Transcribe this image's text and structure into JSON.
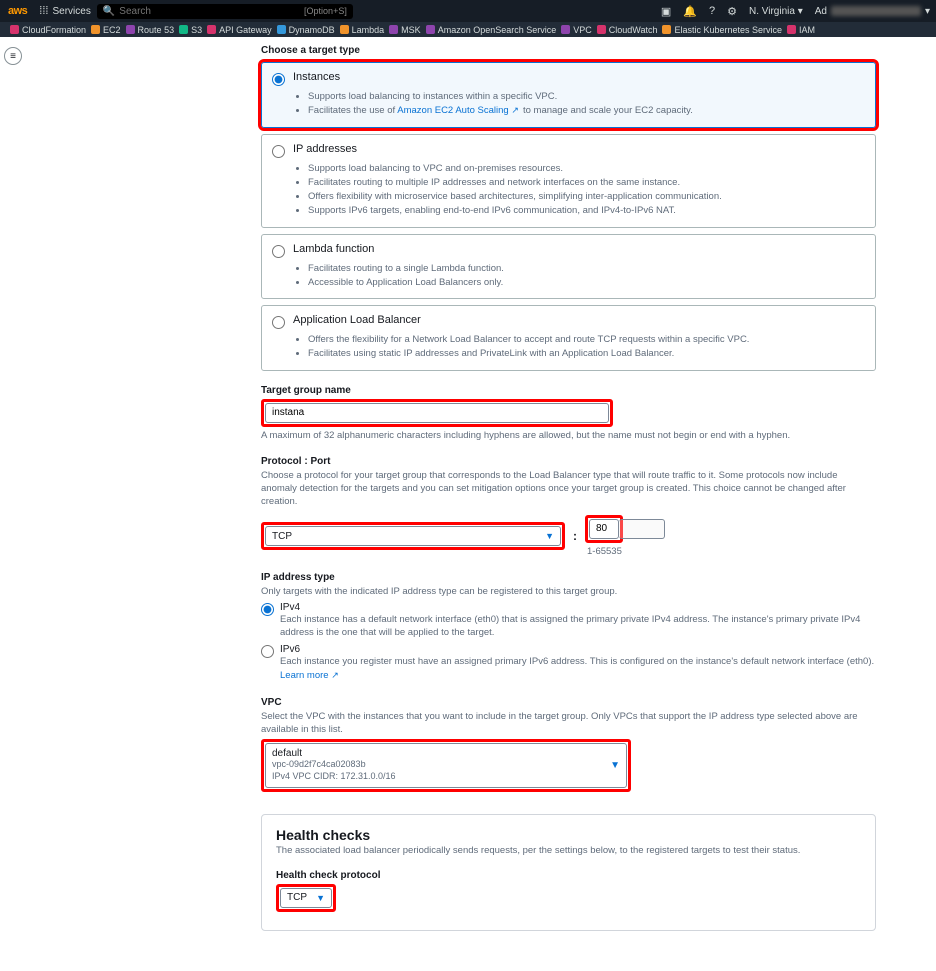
{
  "topbar": {
    "brand": "aws",
    "services_label": "Services",
    "search_placeholder": "Search",
    "search_hint": "[Option+S]",
    "region": "N. Virginia ▾",
    "account_prefix": "Ad"
  },
  "favorites": [
    {
      "label": "CloudFormation",
      "color": "pink"
    },
    {
      "label": "EC2",
      "color": "or"
    },
    {
      "label": "Route 53",
      "color": "pu"
    },
    {
      "label": "S3",
      "color": "gr"
    },
    {
      "label": "API Gateway",
      "color": "pink"
    },
    {
      "label": "DynamoDB",
      "color": "bl"
    },
    {
      "label": "Lambda",
      "color": "or"
    },
    {
      "label": "MSK",
      "color": "pu"
    },
    {
      "label": "Amazon OpenSearch Service",
      "color": "pu"
    },
    {
      "label": "VPC",
      "color": "pu"
    },
    {
      "label": "CloudWatch",
      "color": "pink"
    },
    {
      "label": "Elastic Kubernetes Service",
      "color": "or"
    },
    {
      "label": "IAM",
      "color": "pink"
    }
  ],
  "targetType": {
    "header": "Choose a target type",
    "options": {
      "instances": {
        "label": "Instances",
        "bullets_1": "Supports load balancing to instances within a specific VPC.",
        "bullets_2_pre": "Facilitates the use of ",
        "bullets_2_link": "Amazon EC2 Auto Scaling",
        "bullets_2_post": " to manage and scale your EC2 capacity."
      },
      "ip": {
        "label": "IP addresses",
        "b1": "Supports load balancing to VPC and on-premises resources.",
        "b2": "Facilitates routing to multiple IP addresses and network interfaces on the same instance.",
        "b3": "Offers flexibility with microservice based architectures, simplifying inter-application communication.",
        "b4": "Supports IPv6 targets, enabling end-to-end IPv6 communication, and IPv4-to-IPv6 NAT."
      },
      "lambda": {
        "label": "Lambda function",
        "b1": "Facilitates routing to a single Lambda function.",
        "b2": "Accessible to Application Load Balancers only."
      },
      "alb": {
        "label": "Application Load Balancer",
        "b1": "Offers the flexibility for a Network Load Balancer to accept and route TCP requests within a specific VPC.",
        "b2": "Facilitates using static IP addresses and PrivateLink with an Application Load Balancer."
      }
    }
  },
  "tgName": {
    "label": "Target group name",
    "value": "instana",
    "help": "A maximum of 32 alphanumeric characters including hyphens are allowed, but the name must not begin or end with a hyphen."
  },
  "protocol": {
    "label": "Protocol : Port",
    "help": "Choose a protocol for your target group that corresponds to the Load Balancer type that will route traffic to it. Some protocols now include anomaly detection for the targets and you can set mitigation options once your target group is created. This choice cannot be changed after creation.",
    "value": "TCP",
    "port": "80",
    "port_range": "1-65535"
  },
  "ipType": {
    "label": "IP address type",
    "help": "Only targets with the indicated IP address type can be registered to this target group.",
    "ipv4": {
      "label": "IPv4",
      "desc": "Each instance has a default network interface (eth0) that is assigned the primary private IPv4 address. The instance's primary private IPv4 address is the one that will be applied to the target."
    },
    "ipv6": {
      "label": "IPv6",
      "desc_pre": "Each instance you register must have an assigned primary IPv6 address. This is configured on the instance's default network interface (eth0). ",
      "link": "Learn more"
    }
  },
  "vpc": {
    "label": "VPC",
    "help": "Select the VPC with the instances that you want to include in the target group. Only VPCs that support the IP address type selected above are available in this list.",
    "name": "default",
    "id": "vpc-09d2f7c4ca02083b",
    "cidr_label": "IPv4 VPC CIDR: 172.31.0.0/16"
  },
  "health": {
    "header": "Health checks",
    "sub": "The associated load balancer periodically sends requests, per the settings below, to the registered targets to test their status.",
    "protocol_label": "Health check protocol",
    "protocol_value": "TCP"
  }
}
